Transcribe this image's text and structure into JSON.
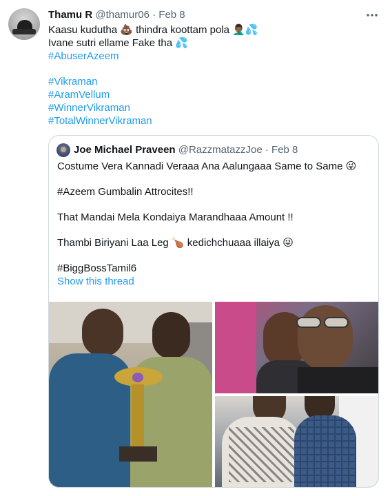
{
  "tweet": {
    "author_name": "Thamu R",
    "author_handle": "@thamur06",
    "separator": " · ",
    "date": "Feb 8",
    "more_icon": "more-horizontal-icon",
    "lines": [
      "Kaasu kudutha 💩 thindra koottam pola 🤦🏾‍♂️💦",
      "Ivane sutri ellame Fake tha 💦"
    ],
    "hashtag_1": "#AbuserAzeem",
    "hashtags": [
      "#Vikraman",
      "#AramVellum",
      "#WinnerVikraman",
      "#TotalWinnerVikraman"
    ]
  },
  "quoted_tweet": {
    "author_name": "Joe Michael Praveen",
    "author_handle": "@RazzmatazzJoe",
    "separator": " · ",
    "date": "Feb 8",
    "paragraphs": [
      "Costume Vera  Kannadi Veraaa Ana Aalungaaa Same to Same 😜",
      "#Azeem Gumbalin Attrocites!!",
      "That Mandai Mela Kondaiya Marandhaaa Amount !!",
      "Thambi Biriyani Laa Leg 🍗 kedichchuaaa illaiya 😜",
      "#BiggBossTamil6"
    ],
    "show_thread": "Show this thread",
    "media_count": 3
  },
  "colors": {
    "link": "#1d9bf0",
    "text": "#0f1419",
    "secondary": "#536471",
    "border": "#cfd9de"
  }
}
